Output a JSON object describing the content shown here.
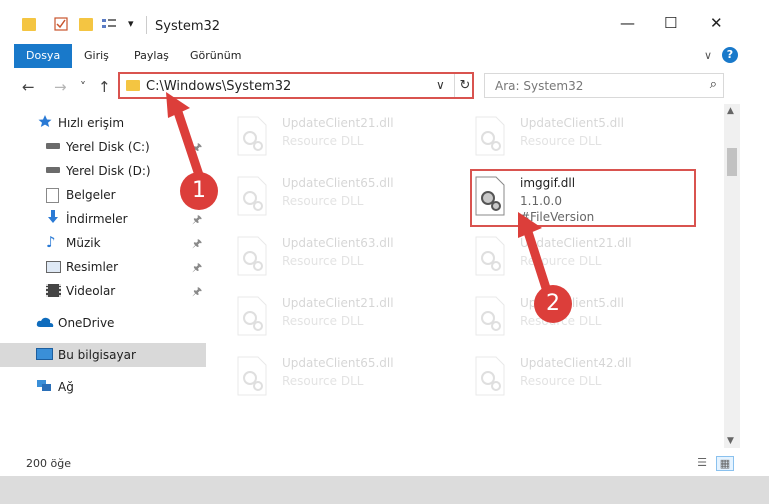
{
  "window": {
    "title": "System32",
    "minimize": "—",
    "maximize": "☐",
    "close": "✕",
    "qat_dropdown": "▾"
  },
  "ribbon": {
    "tabs": [
      "Dosya",
      "Giriş",
      "Paylaş",
      "Görünüm"
    ],
    "expand": "∨",
    "help": "?"
  },
  "nav": {
    "back": "←",
    "forward": "→",
    "recent": "˅",
    "up": "↑"
  },
  "address": {
    "path": "C:\\Windows\\System32",
    "dropdown": "∨",
    "refresh": "↻"
  },
  "search": {
    "placeholder": "Ara: System32",
    "icon": "⌕"
  },
  "sidebar": {
    "items": [
      {
        "label": "Hızlı erişim",
        "icon": "star-icon",
        "pinned": false
      },
      {
        "label": "Yerel Disk (C:)",
        "icon": "drive-c-icon",
        "pinned": true
      },
      {
        "label": "Yerel Disk (D:)",
        "icon": "drive-d-icon",
        "pinned": true
      },
      {
        "label": "Belgeler",
        "icon": "documents-icon",
        "pinned": true
      },
      {
        "label": "İndirmeler",
        "icon": "downloads-icon",
        "pinned": true
      },
      {
        "label": "Müzik",
        "icon": "music-icon",
        "pinned": true
      },
      {
        "label": "Resimler",
        "icon": "pictures-icon",
        "pinned": true
      },
      {
        "label": "Videolar",
        "icon": "videos-icon",
        "pinned": true
      },
      {
        "label": "OneDrive",
        "icon": "cloud-icon",
        "pinned": false
      },
      {
        "label": "Bu bilgisayar",
        "icon": "computer-icon",
        "pinned": false,
        "selected": true
      },
      {
        "label": "Ağ",
        "icon": "network-icon",
        "pinned": false
      }
    ],
    "pin_glyph": "⬢"
  },
  "files": [
    {
      "name": "UpdateClient21.dll",
      "desc": "Resource DLL"
    },
    {
      "name": "UpdateClient5.dll",
      "desc": "Resource DLL"
    },
    {
      "name": "UpdateClient65.dll",
      "desc": "Resource DLL"
    },
    {
      "name": "imggif.dll",
      "desc": "1.1.0.0",
      "desc2": "#FileVersion",
      "highlighted": true
    },
    {
      "name": "UpdateClient63.dll",
      "desc": "Resource DLL"
    },
    {
      "name": "UpdateClient21.dll",
      "desc": "Resource DLL"
    },
    {
      "name": "UpdateClient21.dll",
      "desc": "Resource DLL"
    },
    {
      "name": "UpdateClient5.dll",
      "desc": "Resource DLL"
    },
    {
      "name": "UpdateClient65.dll",
      "desc": "Resource DLL"
    },
    {
      "name": "UpdateClient42.dll",
      "desc": "Resource DLL"
    }
  ],
  "status": {
    "count": "200 öğe"
  },
  "annotations": {
    "step1": "1",
    "step2": "2",
    "color": "#dc3e3a"
  }
}
